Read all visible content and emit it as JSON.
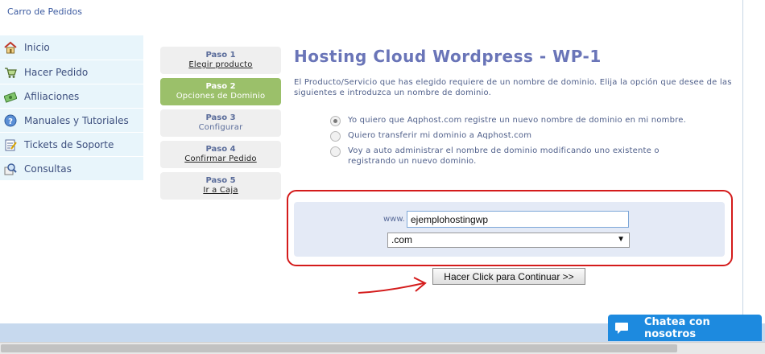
{
  "header": {
    "breadcrumb": "Carro de Pedidos"
  },
  "sidebar": {
    "items": [
      {
        "label": "Inicio",
        "icon": "home-icon"
      },
      {
        "label": "Hacer Pedido",
        "icon": "cart-icon"
      },
      {
        "label": "Afiliaciones",
        "icon": "money-icon"
      },
      {
        "label": "Manuales y Tutoriales",
        "icon": "help-icon"
      },
      {
        "label": "Tickets de Soporte",
        "icon": "ticket-icon"
      },
      {
        "label": "Consultas",
        "icon": "search-icon"
      }
    ]
  },
  "steps": [
    {
      "num": "Paso 1",
      "name": "Elegir producto"
    },
    {
      "num": "Paso 2",
      "name": "Opciones de Dominio"
    },
    {
      "num": "Paso 3",
      "name": "Configurar"
    },
    {
      "num": "Paso 4",
      "name": "Confirmar Pedido"
    },
    {
      "num": "Paso 5",
      "name": "Ir a Caja"
    }
  ],
  "main": {
    "title": "Hosting Cloud Wordpress - WP-1",
    "intro": "El Producto/Servicio que has elegido requiere de un nombre de dominio. Elija la opción que desee de las siguientes e introduzca un nombre de dominio.",
    "options": [
      {
        "label": "Yo quiero que Aqphost.com registre un nuevo nombre de dominio en mi nombre.",
        "selected": true
      },
      {
        "label": "Quiero transferir mi dominio a Aqphost.com",
        "selected": false
      },
      {
        "label": "Voy a auto administrar el nombre de dominio modificando uno existente o registrando un nuevo dominio.",
        "selected": false
      }
    ],
    "www_prefix": "www.",
    "domain_value": "ejemplohostingwp",
    "tld_selected": ".com",
    "continue_label": "Hacer Click para Continuar >>"
  },
  "chat": {
    "label": "Chatea con nosotros"
  },
  "colors": {
    "accent": "#6a75b8",
    "active_step": "#9bc06a",
    "chat": "#1d8adf",
    "annotation": "#d41b1b"
  }
}
